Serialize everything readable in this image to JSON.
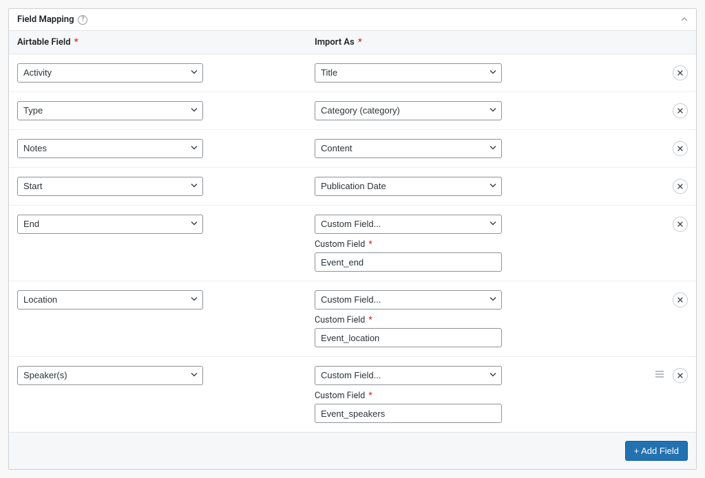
{
  "panel_title": "Field Mapping",
  "columns": {
    "airtable_field": "Airtable Field",
    "import_as": "Import As"
  },
  "custom_field_label": "Custom Field",
  "add_field_label": "+ Add Field",
  "rows": [
    {
      "airtable": "Activity",
      "import_as": "Title",
      "has_custom": false,
      "custom_value": "",
      "show_drag": false
    },
    {
      "airtable": "Type",
      "import_as": "Category (category)",
      "has_custom": false,
      "custom_value": "",
      "show_drag": false
    },
    {
      "airtable": "Notes",
      "import_as": "Content",
      "has_custom": false,
      "custom_value": "",
      "show_drag": false
    },
    {
      "airtable": "Start",
      "import_as": "Publication Date",
      "has_custom": false,
      "custom_value": "",
      "show_drag": false
    },
    {
      "airtable": "End",
      "import_as": "Custom Field...",
      "has_custom": true,
      "custom_value": "Event_end",
      "show_drag": false
    },
    {
      "airtable": "Location",
      "import_as": "Custom Field...",
      "has_custom": true,
      "custom_value": "Event_location",
      "show_drag": false
    },
    {
      "airtable": "Speaker(s)",
      "import_as": "Custom Field...",
      "has_custom": true,
      "custom_value": "Event_speakers",
      "show_drag": true
    }
  ]
}
